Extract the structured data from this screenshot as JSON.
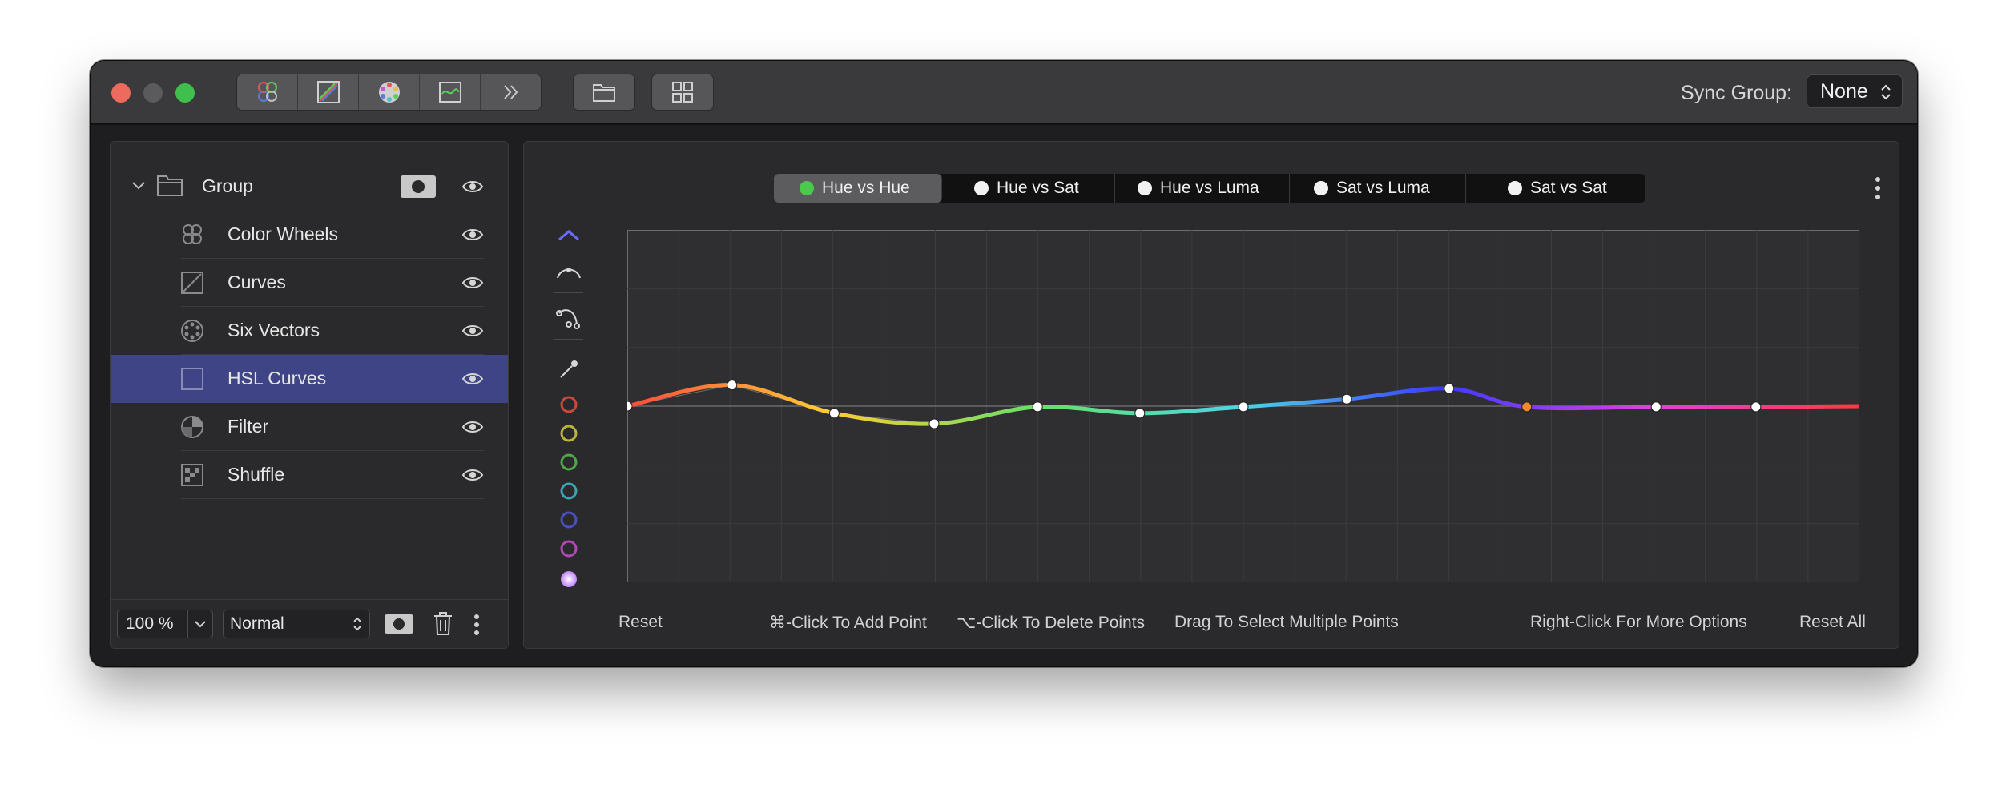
{
  "window": {
    "toolbar_icons": [
      "color-wheels-icon",
      "curves-icon",
      "six-vectors-icon",
      "hsl-icon",
      "double-chevron-icon"
    ],
    "folder_icon": "folder-icon",
    "grid_icon": "grid-icon",
    "sync_group": {
      "label": "Sync Group:",
      "value": "None"
    }
  },
  "layers": {
    "group": {
      "label": "Group"
    },
    "items": [
      {
        "label": "Color Wheels",
        "icon": "color-wheels-icon"
      },
      {
        "label": "Curves",
        "icon": "curves-icon"
      },
      {
        "label": "Six Vectors",
        "icon": "six-vectors-icon"
      },
      {
        "label": "HSL Curves",
        "icon": "hsl-curves-icon",
        "selected": true
      },
      {
        "label": "Filter",
        "icon": "filter-icon"
      },
      {
        "label": "Shuffle",
        "icon": "shuffle-icon"
      }
    ],
    "footer": {
      "opacity": "100 %",
      "blend_mode": "Normal"
    }
  },
  "curves": {
    "tabs": [
      {
        "label": "Hue vs Hue",
        "active": true,
        "dot_color": "#4cc94c"
      },
      {
        "label": "Hue vs Sat",
        "active": false,
        "dot_color": "#f2f2f2"
      },
      {
        "label": "Hue vs Luma",
        "active": false,
        "dot_color": "#f2f2f2"
      },
      {
        "label": "Sat vs Luma",
        "active": false,
        "dot_color": "#f2f2f2"
      },
      {
        "label": "Sat vs Sat",
        "active": false,
        "dot_color": "#f2f2f2"
      }
    ],
    "swatches": [
      "#c8483a",
      "#b8b43c",
      "#4ea84a",
      "#3fa3b3",
      "#4a50c0",
      "#b048b8"
    ],
    "curve_points": [
      {
        "x": 0.0,
        "y": 0.5
      },
      {
        "x": 0.085,
        "y": 0.44
      },
      {
        "x": 0.168,
        "y": 0.52
      },
      {
        "x": 0.249,
        "y": 0.55
      },
      {
        "x": 0.333,
        "y": 0.502
      },
      {
        "x": 0.416,
        "y": 0.52
      },
      {
        "x": 0.5,
        "y": 0.502
      },
      {
        "x": 0.584,
        "y": 0.48
      },
      {
        "x": 0.667,
        "y": 0.45
      },
      {
        "x": 0.73,
        "y": 0.502,
        "selected": true
      },
      {
        "x": 0.835,
        "y": 0.502
      },
      {
        "x": 0.916,
        "y": 0.502
      }
    ],
    "footer": {
      "reset": "Reset",
      "hint_add": "⌘-Click To Add Point",
      "hint_delete": "⌥-Click To Delete Points",
      "hint_drag": "Drag To Select Multiple Points",
      "hint_right": "Right-Click For More Options",
      "reset_all": "Reset All"
    }
  }
}
